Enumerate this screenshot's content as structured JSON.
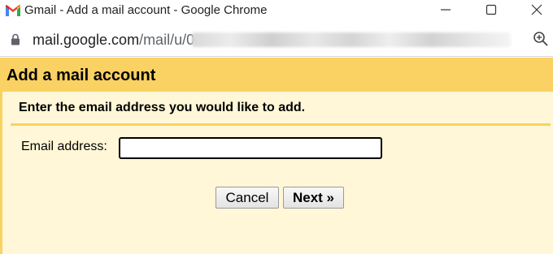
{
  "window": {
    "title": "Gmail - Add a mail account - Google Chrome"
  },
  "addressbar": {
    "url_host": "mail.google.com",
    "url_path": "/mail/u/0"
  },
  "dialog": {
    "title": "Add a mail account",
    "instruction": "Enter the email address you would like to add.",
    "email_label": "Email address:",
    "email_value": "",
    "cancel_label": "Cancel",
    "next_label": "Next »"
  },
  "colors": {
    "header": "#fad163",
    "background": "#fff7d7"
  },
  "icons": [
    "gmail-logo-icon",
    "minimize-icon",
    "maximize-icon",
    "close-icon",
    "lock-icon",
    "zoom-icon"
  ]
}
